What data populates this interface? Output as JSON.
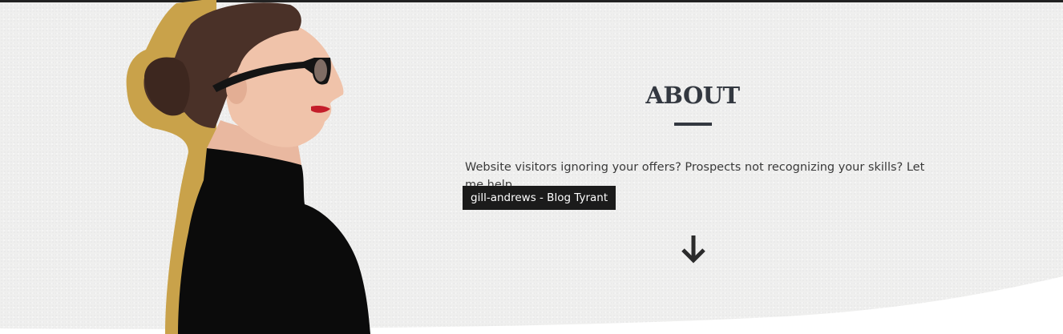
{
  "about": {
    "title": "ABOUT",
    "description": "Website visitors ignoring your offers? Prospects not recognizing your skills? Let me help."
  },
  "tooltip": {
    "text": "gill-andrews - Blog Tyrant"
  },
  "icons": {
    "scroll_down": "arrow-down-icon"
  },
  "colors": {
    "background": "#efefee",
    "title": "#333840",
    "accent_gold": "#c9a24a",
    "tooltip_bg": "#1b1b1b",
    "top_bar": "#222222"
  }
}
